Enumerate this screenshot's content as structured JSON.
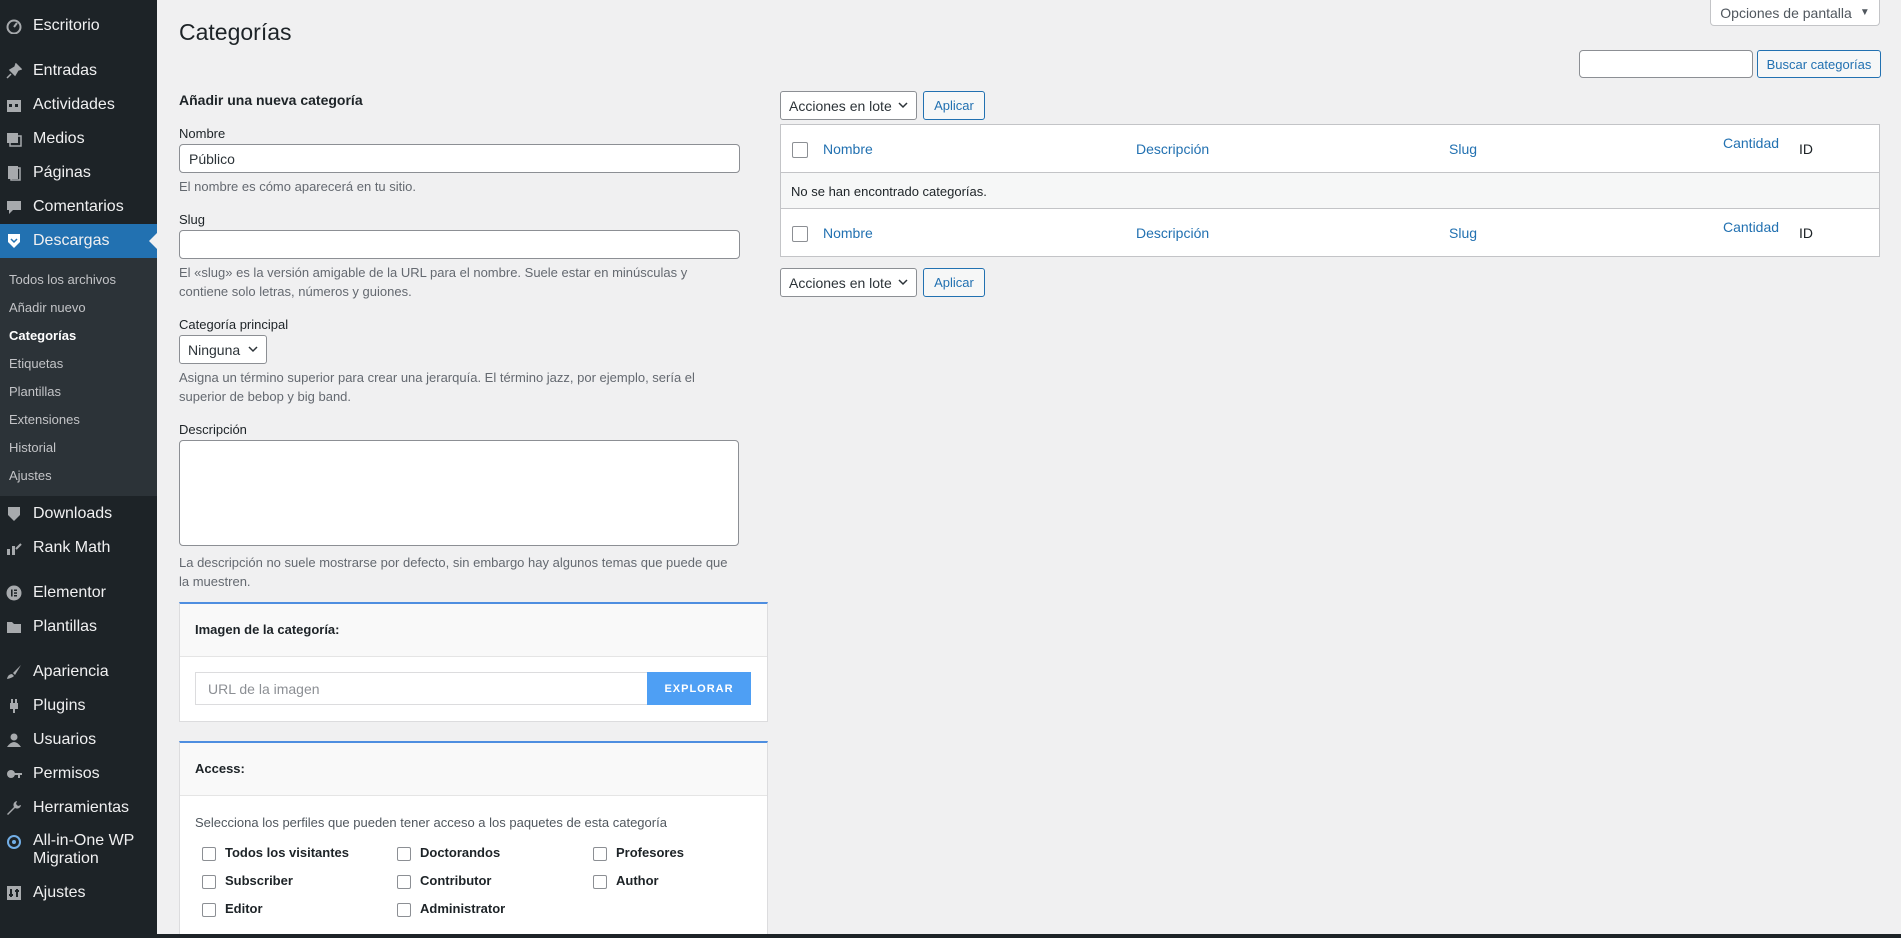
{
  "sidebar": {
    "menu": [
      {
        "label": "Escritorio",
        "icon": "dashboard-icon"
      },
      {
        "label": "Entradas",
        "icon": "pin-icon"
      },
      {
        "label": "Actividades",
        "icon": "calendar-icon"
      },
      {
        "label": "Medios",
        "icon": "media-icon"
      },
      {
        "label": "Páginas",
        "icon": "page-icon"
      },
      {
        "label": "Comentarios",
        "icon": "comment-icon"
      },
      {
        "label": "Descargas",
        "icon": "download-icon"
      },
      {
        "label": "Downloads",
        "icon": "download-icon"
      },
      {
        "label": "Rank Math",
        "icon": "chart-icon"
      },
      {
        "label": "Elementor",
        "icon": "elementor-icon"
      },
      {
        "label": "Plantillas",
        "icon": "folder-icon"
      },
      {
        "label": "Apariencia",
        "icon": "brush-icon"
      },
      {
        "label": "Plugins",
        "icon": "plugin-icon"
      },
      {
        "label": "Usuarios",
        "icon": "user-icon"
      },
      {
        "label": "Permisos",
        "icon": "key-icon"
      },
      {
        "label": "Herramientas",
        "icon": "wrench-icon"
      },
      {
        "label": "All-in-One WP",
        "label2": "Migration",
        "icon": "migration-icon"
      },
      {
        "label": "Ajustes",
        "icon": "settings-icon"
      }
    ],
    "submenu": [
      "Todos los archivos",
      "Añadir nuevo",
      "Categorías",
      "Etiquetas",
      "Plantillas",
      "Extensiones",
      "Historial",
      "Ajustes"
    ]
  },
  "header": {
    "title": "Categorías",
    "screen_options": "Opciones de pantalla",
    "search_button": "Buscar categorías",
    "search_value": ""
  },
  "form": {
    "heading": "Añadir una nueva categoría",
    "name_label": "Nombre",
    "name_value": "Público",
    "name_hint": "El nombre es cómo aparecerá en tu sitio.",
    "slug_label": "Slug",
    "slug_value": "",
    "slug_hint": "El «slug» es la versión amigable de la URL para el nombre. Suele estar en minúsculas y contiene solo letras, números y guiones.",
    "parent_label": "Categoría principal",
    "parent_value": "Ninguna",
    "parent_hint": "Asigna un término superior para crear una jerarquía. El término jazz, por ejemplo, sería el superior de bebop y big band.",
    "desc_label": "Descripción",
    "desc_hint": "La descripción no suele mostrarse por defecto, sin embargo hay algunos temas que puede que la muestren."
  },
  "image_card": {
    "title": "Imagen de la categoría:",
    "url_placeholder": "URL de la imagen",
    "explore_button": "EXPLORAR"
  },
  "access_card": {
    "title": "Access:",
    "description": "Selecciona los perfiles que pueden tener acceso a los paquetes de esta categoría",
    "roles": [
      "Todos los visitantes",
      "Doctorandos",
      "Profesores",
      "Subscriber",
      "Contributor",
      "Author",
      "Editor",
      "Administrator"
    ]
  },
  "table": {
    "bulk_action": "Acciones en lote",
    "apply": "Aplicar",
    "columns": [
      "Nombre",
      "Descripción",
      "Slug",
      "Cantidad",
      "ID"
    ],
    "empty_message": "No se han encontrado categorías."
  }
}
